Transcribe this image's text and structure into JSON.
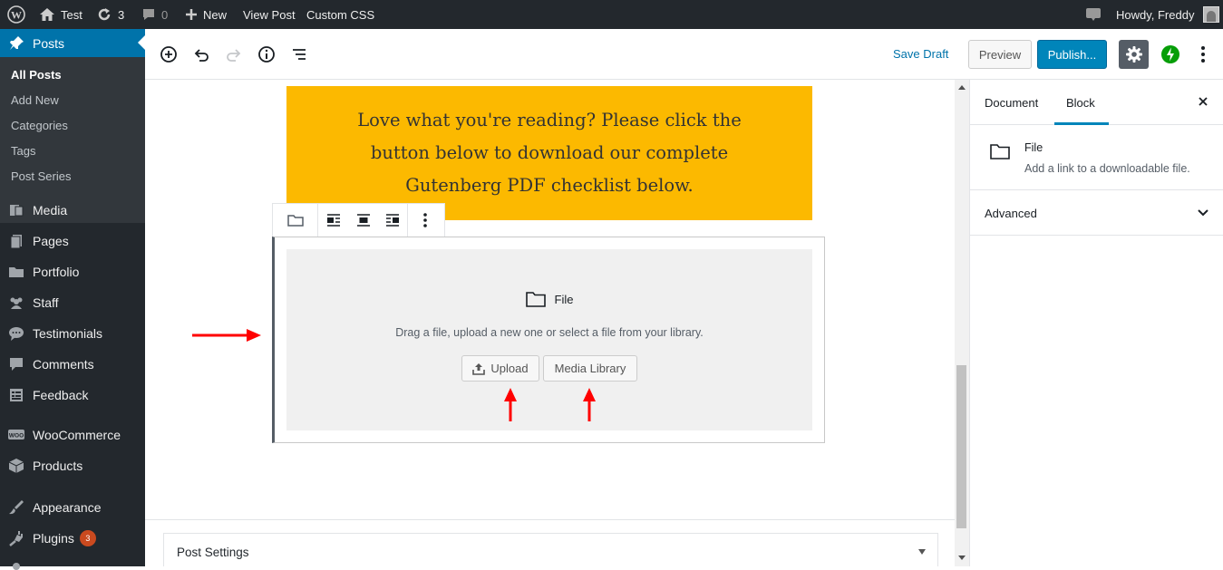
{
  "adminbar": {
    "site_name": "Test",
    "updates_count": "3",
    "comments_count": "0",
    "new_label": "New",
    "view_post_label": "View Post",
    "custom_css_label": "Custom CSS",
    "howdy_label": "Howdy, Freddy"
  },
  "sidebar": {
    "posts_label": "Posts",
    "submenu": [
      "All Posts",
      "Add New",
      "Categories",
      "Tags",
      "Post Series"
    ],
    "items": [
      {
        "label": "Media",
        "icon": "media-icon"
      },
      {
        "label": "Pages",
        "icon": "pages-icon"
      },
      {
        "label": "Portfolio",
        "icon": "portfolio-icon"
      },
      {
        "label": "Staff",
        "icon": "staff-icon"
      },
      {
        "label": "Testimonials",
        "icon": "testimonials-icon"
      },
      {
        "label": "Comments",
        "icon": "comments-icon"
      },
      {
        "label": "Feedback",
        "icon": "feedback-icon"
      },
      {
        "label": "WooCommerce",
        "icon": "woocommerce-icon"
      },
      {
        "label": "Products",
        "icon": "products-icon"
      },
      {
        "label": "Appearance",
        "icon": "appearance-icon"
      },
      {
        "label": "Plugins",
        "icon": "plugins-icon",
        "badge": "3"
      }
    ]
  },
  "toolbar": {
    "save_draft": "Save Draft",
    "preview": "Preview",
    "publish": "Publish..."
  },
  "editor": {
    "callout_text": "Love what you're reading? Please click the button below to download our complete Gutenberg PDF checklist below.",
    "file_block": {
      "title": "File",
      "instructions": "Drag a file, upload a new one or select a file from your library.",
      "upload_label": "Upload",
      "media_library_label": "Media Library"
    },
    "post_settings_label": "Post Settings"
  },
  "panel": {
    "tabs": [
      "Document",
      "Block"
    ],
    "active_tab": "Block",
    "block_name": "File",
    "block_description": "Add a link to a downloadable file.",
    "advanced_label": "Advanced"
  },
  "colors": {
    "admin_dark": "#23282d",
    "accent": "#0073aa",
    "callout": "#fcb900",
    "arrow": "#ff0000",
    "jetpack": "#069e08"
  }
}
